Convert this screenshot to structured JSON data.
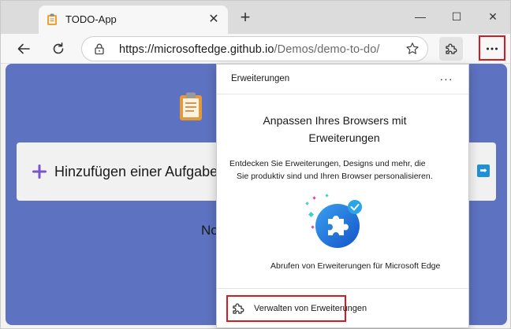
{
  "tab": {
    "title": "TODO-App",
    "close_glyph": "✕"
  },
  "new_tab_glyph": "+",
  "window_controls": {
    "minimize": "—",
    "maximize": "☐",
    "close": "✕"
  },
  "address": {
    "host": "https://microsoftedge.github.io",
    "path": "/Demos/demo-to-do/"
  },
  "page": {
    "add_task": "Hinzufügen einer Aufgabe",
    "empty_partial": "No",
    "submit_glyph": "➡"
  },
  "extensions_popup": {
    "title": "Erweiterungen",
    "more_glyph": "···",
    "headline_line1": "Anpassen Ihres Browsers mit",
    "headline_line2": "Erweiterungen",
    "description_line1": "Entdecken Sie Erweiterungen, Designs und mehr, die",
    "description_line2": "Sie produktiv sind und Ihren Browser personalisieren.",
    "get_extensions": "Abrufen von Erweiterungen für Microsoft Edge",
    "manage_extensions": "Verwalten von Erweiterungen"
  },
  "colors": {
    "page_background": "#5d72c0",
    "highlight_border": "#d71920",
    "accent_blue": "#1e6fe0"
  }
}
